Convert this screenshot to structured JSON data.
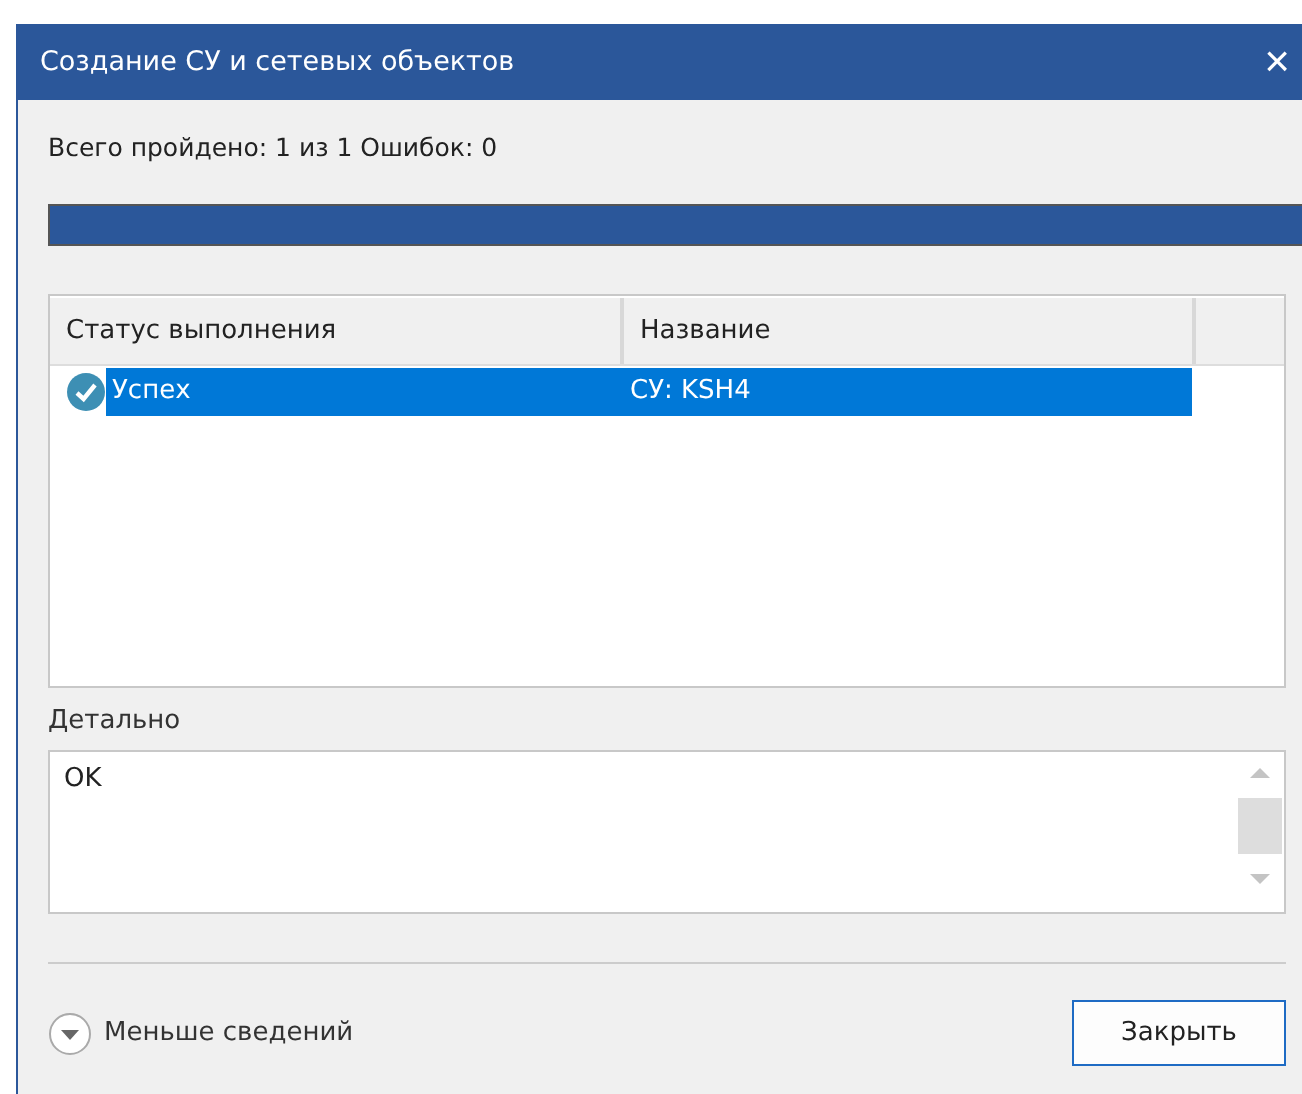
{
  "window": {
    "title": "Создание СУ и сетевых объектов",
    "close": "×"
  },
  "summary": "Всего пройдено: 1 из 1 Ошибок: 0",
  "progress": {
    "level": 1
  },
  "table": {
    "columns": [
      "Статус выполнения",
      "Название"
    ],
    "rows": [
      {
        "status": "Успех",
        "kind": "success",
        "name": "СУ: KSH4",
        "selected": true
      }
    ]
  },
  "details": {
    "label": "Детально",
    "value": "OK"
  },
  "toggle": {
    "label": "Меньше сведений",
    "expanded": true
  },
  "buttons": [
    "Закрыть"
  ]
}
